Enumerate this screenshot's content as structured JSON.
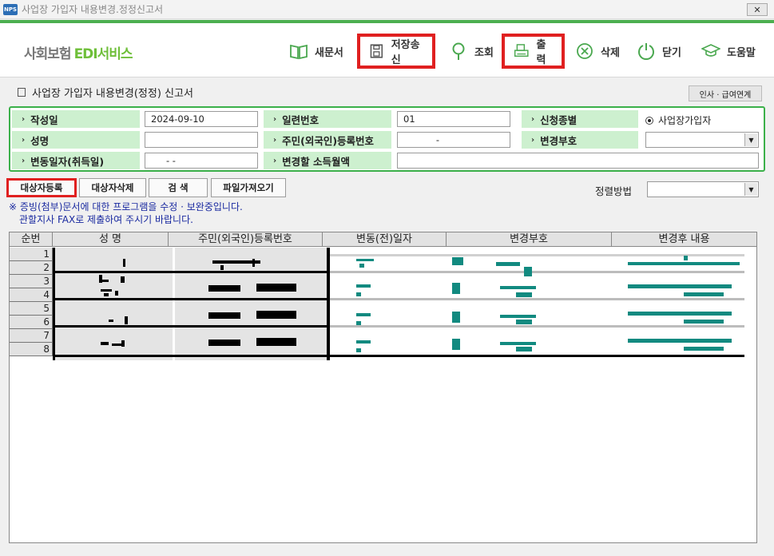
{
  "window": {
    "app_badge": "NPS",
    "title": "사업장 가입자 내용변경.정정신고서",
    "close_glyph": "✕"
  },
  "brand": {
    "part1": "사회보험",
    "part2": "EDI서비스"
  },
  "toolbar": {
    "new": "새문서",
    "save_send": "저장송신",
    "search": "조회",
    "print": "출력",
    "delete": "삭제",
    "close": "닫기",
    "help": "도움말"
  },
  "form": {
    "title": "사업장 가입자 내용변경(정정) 신고서",
    "side_button": "인사 · 급여연계",
    "labels": {
      "written_date": "작성일",
      "serial_no": "일련번호",
      "apply_type": "신청종별",
      "name": "성명",
      "resident_no": "주민(외국인)등록번호",
      "change_code": "변경부호",
      "change_date": "변동일자(취득일)",
      "income_month": "변경할 소득월액"
    },
    "values": {
      "written_date": "2024-09-10",
      "serial_no": "01",
      "apply_type": "사업장가입자",
      "name": "",
      "resident_no": "-",
      "change_code": "",
      "change_date": "-  -",
      "income_month": ""
    }
  },
  "actions": {
    "register": "대상자등록",
    "delete_target": "대상자삭제",
    "search": "검   색",
    "import_file": "파일가져오기",
    "sort_label": "정렬방법",
    "sort_value": ""
  },
  "notice": {
    "line1": "※ 증빙(첨부)문서에 대한 프로그램을 수정 · 보완중입니다.",
    "line2": "관할지사 FAX로 제출하여 주시기 바랍니다."
  },
  "grid": {
    "columns": [
      "순번",
      "성  명",
      "주민(외국인)등록번호",
      "변동(전)일자",
      "변경부호",
      "변경후 내용"
    ],
    "row_numbers": [
      "1",
      "2",
      "3",
      "4",
      "5",
      "6",
      "7",
      "8"
    ]
  },
  "colors": {
    "accent_green": "#4caf50",
    "label_bg": "#cdf0cf",
    "highlight_red": "#e02020",
    "notice_blue": "#1a2aa0",
    "masked_teal": "#128a80"
  }
}
